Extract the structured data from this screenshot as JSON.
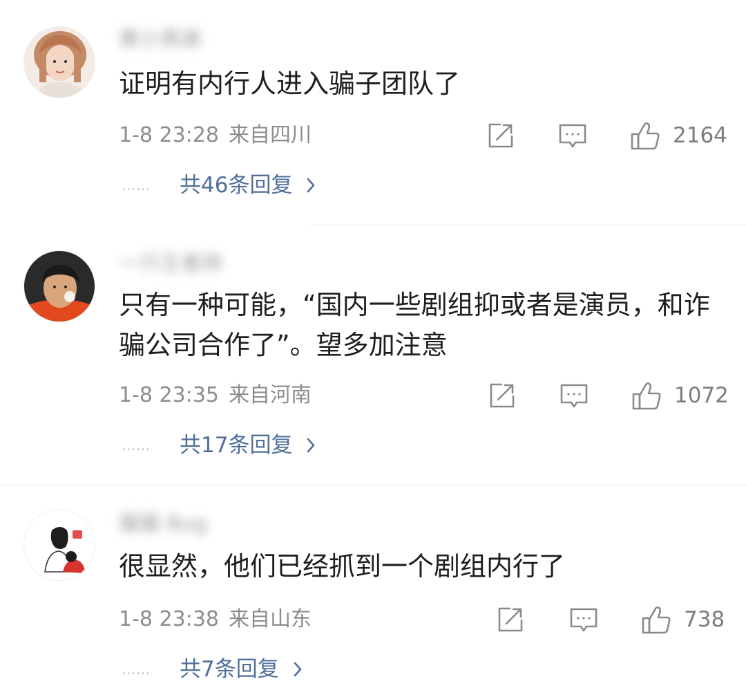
{
  "comments": [
    {
      "username": "黄小燕弟",
      "text": "证明有内行人进入骗子团队了",
      "time": "1-8 23:28",
      "location": "来自四川",
      "likes": "2164",
      "replies_label": "共46条回复",
      "dots": "……"
    },
    {
      "username": "一只王者帅",
      "text": "只有一种可能，“国内一些剧组抑或者是演员，和诈骗公司合作了”。望多加注意",
      "time": "1-8 23:35",
      "location": "来自河南",
      "likes": "1072",
      "replies_label": "共17条回复",
      "dots": "……"
    },
    {
      "username": "猫猫 Bug",
      "text": "很显然，他们已经抓到一个剧组内行了",
      "time": "1-8 23:38",
      "location": "来自山东",
      "likes": "738",
      "replies_label": "共7条回复",
      "dots": "……"
    }
  ],
  "icons": {
    "share": "share-icon",
    "comment": "comment-icon",
    "like": "thumbs-up-icon",
    "chevron": "chevron-right-icon"
  },
  "colors": {
    "reply_link": "#4f6f9a",
    "meta": "#8d8d8d",
    "icon": "#8a8a8a"
  }
}
